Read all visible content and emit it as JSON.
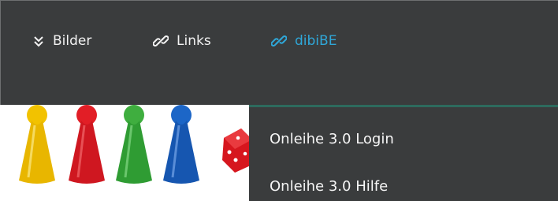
{
  "nav": {
    "items": [
      {
        "label": "Bilder",
        "icon": "double-chevron-down-icon"
      },
      {
        "label": "Links",
        "icon": "link-icon"
      },
      {
        "label": "dibiBE",
        "icon": "link-icon",
        "active": true
      }
    ]
  },
  "dropdown": {
    "items": [
      {
        "label": "Onleihe 3.0 Login"
      },
      {
        "label": "Onleihe 3.0 Hilfe"
      }
    ]
  },
  "colors": {
    "navbar_bg": "#3a3c3d",
    "active_link": "#2fa7d8",
    "dropdown_accent": "#2d6b5e"
  }
}
